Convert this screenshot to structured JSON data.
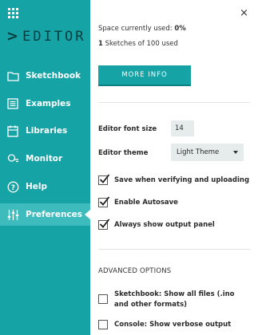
{
  "sidebar": {
    "brand": "EDITOR",
    "brand_chevron": ">",
    "items": [
      {
        "label": "Sketchbook",
        "icon": "folder-icon"
      },
      {
        "label": "Examples",
        "icon": "list-icon"
      },
      {
        "label": "Libraries",
        "icon": "library-icon"
      },
      {
        "label": "Monitor",
        "icon": "monitor-icon"
      },
      {
        "label": "Help",
        "icon": "help-icon"
      },
      {
        "label": "Preferences",
        "icon": "sliders-icon",
        "active": true
      }
    ]
  },
  "panel": {
    "close_glyph": "×",
    "space_label": "Space currently used:",
    "space_value": "0%",
    "sketches_count": "1",
    "sketches_text": "Sketches of 100 used",
    "more_info": "MORE INFO",
    "font_size_label": "Editor font size",
    "font_size_value": "14",
    "theme_label": "Editor theme",
    "theme_value": "Light Theme",
    "checks": [
      {
        "label": "Save when verifying and uploading",
        "checked": true
      },
      {
        "label": "Enable Autosave",
        "checked": true
      },
      {
        "label": "Always show output panel",
        "checked": true
      }
    ],
    "advanced_title": "ADVANCED OPTIONS",
    "advanced": [
      {
        "label": "Sketchbook: Show all files (.ino and other formats)",
        "checked": false
      },
      {
        "label": "Console: Show verbose output",
        "checked": false
      }
    ]
  },
  "colors": {
    "sidebar": "#16a3a6",
    "sidebar_active": "#3ebbbd",
    "brand": "#063d40",
    "button": "#16a3a6"
  }
}
